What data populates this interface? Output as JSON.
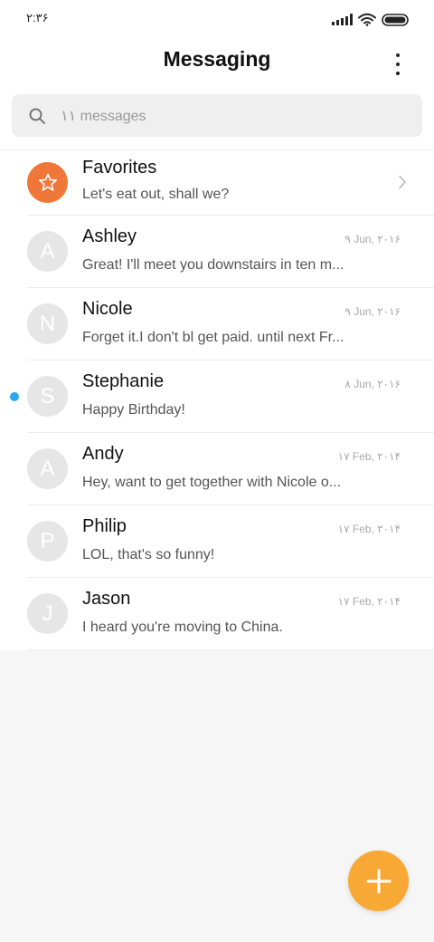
{
  "status_bar": {
    "time": "۲:۳۶",
    "icons": [
      "signal-icon",
      "wifi-icon",
      "battery-icon"
    ]
  },
  "header": {
    "title": "Messaging",
    "menu_icon": "more-vertical-icon"
  },
  "search": {
    "placeholder": "۱۱ messages",
    "icon": "search-icon"
  },
  "favorites": {
    "name": "Favorites",
    "preview": "Let's eat out, shall we?",
    "icon": "star-icon",
    "color": "#f0773a"
  },
  "conversations": [
    {
      "initial": "A",
      "name": "Ashley",
      "preview": "Great! I'll meet you downstairs in ten m...",
      "date": "۹ Jun, ۲۰۱۶",
      "unread": false
    },
    {
      "initial": "N",
      "name": "Nicole",
      "preview": "Forget it.I don't bl get paid. until next Fr...",
      "date": "۹ Jun, ۲۰۱۶",
      "unread": false
    },
    {
      "initial": "S",
      "name": "Stephanie",
      "preview": "Happy Birthday!",
      "date": "۸ Jun, ۲۰۱۶",
      "unread": true
    },
    {
      "initial": "A",
      "name": "Andy",
      "preview": "Hey, want to get together with Nicole o...",
      "date": "۱۷ Feb, ۲۰۱۴",
      "unread": false
    },
    {
      "initial": "P",
      "name": "Philip",
      "preview": "LOL, that's so funny!",
      "date": "۱۷ Feb, ۲۰۱۴",
      "unread": false
    },
    {
      "initial": "J",
      "name": "Jason",
      "preview": "I heard you're moving to China.",
      "date": "۱۷ Feb, ۲۰۱۴",
      "unread": false
    }
  ],
  "fab": {
    "icon": "plus-icon",
    "color": "#f8a935"
  },
  "colors": {
    "unread_dot": "#2aa7ee",
    "avatar_bg": "#e6e6e6"
  }
}
